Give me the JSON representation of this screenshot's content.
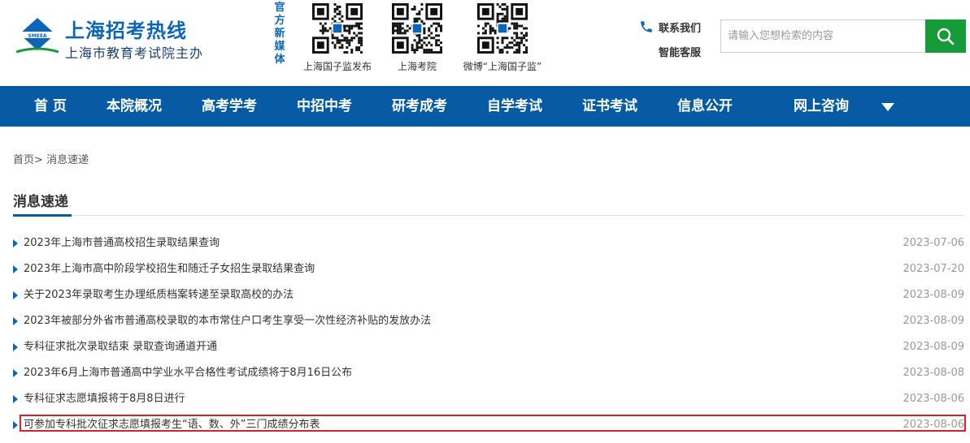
{
  "header": {
    "site_title": "上海招考热线",
    "site_subtitle": "上海市教育考试院主办",
    "logo_text": "SMEEA",
    "media_label": [
      "官",
      "方",
      "新",
      "媒",
      "体"
    ],
    "qrcodes": [
      {
        "caption": "上海国子监发布"
      },
      {
        "caption": "上海考院"
      },
      {
        "caption": "微博“上海国子监”"
      }
    ],
    "contact_label": "联系我们",
    "service_label": "智能客服",
    "search": {
      "placeholder": "请输入您想检索的内容",
      "value": ""
    }
  },
  "nav": {
    "items": [
      "首 页",
      "本院概况",
      "高考学考",
      "中招中考",
      "研考成考",
      "自学考试",
      "证书考试",
      "信息公开",
      "网上咨询"
    ]
  },
  "breadcrumb": {
    "home": "首页",
    "separator": ">",
    "current": "消息速递"
  },
  "section": {
    "title": "消息速递"
  },
  "news": [
    {
      "title": "2023年上海市普通高校招生录取结果查询",
      "date": "2023-07-06"
    },
    {
      "title": "2023年上海市高中阶段学校招生和随迁子女招生录取结果查询",
      "date": "2023-07-20"
    },
    {
      "title": "关于2023年录取考生办理纸质档案转递至录取高校的办法",
      "date": "2023-08-09"
    },
    {
      "title": "2023年被部分外省市普通高校录取的本市常住户口考生享受一次性经济补贴的发放办法",
      "date": "2023-08-09"
    },
    {
      "title": "专科征求批次录取结束 录取查询通道开通",
      "date": "2023-08-09"
    },
    {
      "title": "2023年6月上海市普通高中学业水平合格性考试成绩将于8月16日公布",
      "date": "2023-08-08"
    },
    {
      "title": "专科征求志愿填报将于8月8日进行",
      "date": "2023-08-06"
    },
    {
      "title": "可参加专科批次征求志愿填报考生“语、数、外”三门成绩分布表",
      "date": "2023-08-06"
    }
  ],
  "colors": {
    "nav_bg": "#075aa4",
    "brand_blue": "#0c66b8",
    "search_btn": "#169b3a",
    "highlight": "#d6212b"
  },
  "icons": {
    "phone": "phone-icon",
    "search": "search-icon",
    "nav_more": "chevron-down-icon"
  }
}
